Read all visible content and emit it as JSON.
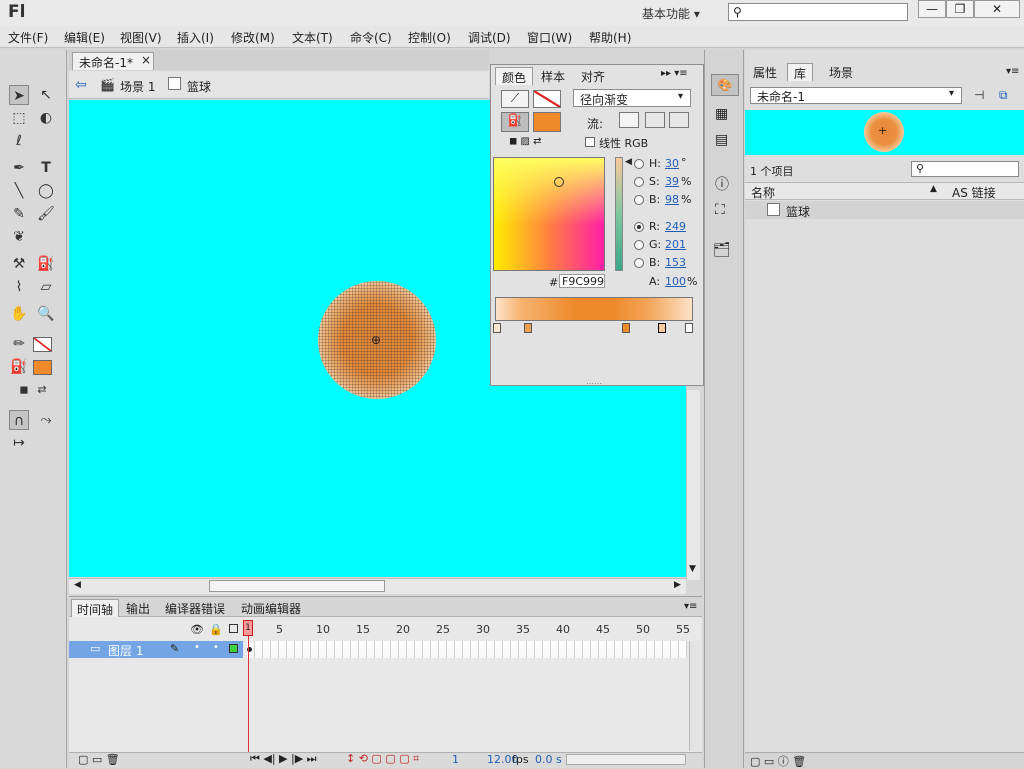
{
  "app": {
    "logo": "Fl",
    "workspace": "基本功能",
    "workspace_arrow": "▾",
    "win_min": "—",
    "win_restore": "❐",
    "win_close": "✕"
  },
  "menu": [
    "文件(F)",
    "编辑(E)",
    "视图(V)",
    "插入(I)",
    "修改(M)",
    "文本(T)",
    "命令(C)",
    "控制(O)",
    "调试(D)",
    "窗口(W)",
    "帮助(H)"
  ],
  "document": {
    "tab_label": "未命名-1*",
    "tab_close": "×",
    "breadcrumb_scene": "场景 1",
    "breadcrumb_symbol": "篮球"
  },
  "color_panel": {
    "tabs": [
      "颜色",
      "样本",
      "对齐"
    ],
    "fill_type": "径向渐变",
    "flow_label": "流:",
    "linear_rgb_label": "线性 RGB",
    "h_label": "H:",
    "h_value": "30",
    "h_unit": "°",
    "s_label": "S:",
    "s_value": "39",
    "s_unit": "%",
    "b_label": "B:",
    "b_value": "98",
    "b_unit": "%",
    "r_label": "R:",
    "r_value": "249",
    "g_label": "G:",
    "g_value": "201",
    "bb_label": "B:",
    "bb_value": "153",
    "a_label": "A:",
    "a_value": "100",
    "a_unit": "%",
    "hex_label": "#",
    "hex_value": "F9C999",
    "colors": {
      "selected": "#F9C999",
      "fill_swatch": "#EE8A2A"
    }
  },
  "library_panel": {
    "tabs": [
      "属性",
      "库",
      "场景"
    ],
    "document_select": "未命名-1",
    "item_count": "1 个项目",
    "col_name": "名称",
    "col_linkage": "AS 链接",
    "items": [
      {
        "name": "篮球"
      }
    ]
  },
  "timeline": {
    "tabs": [
      "时间轴",
      "输出",
      "编译器错误",
      "动画编辑器"
    ],
    "layer_name": "图层 1",
    "frame_numbers": [
      "1",
      "5",
      "10",
      "15",
      "20",
      "25",
      "30",
      "35",
      "40",
      "45",
      "50",
      "55"
    ],
    "current_frame": "1",
    "fps": "12.00",
    "fps_unit": "fps",
    "time": "0.0 s"
  },
  "stage": {
    "background": "#00FFFF"
  }
}
